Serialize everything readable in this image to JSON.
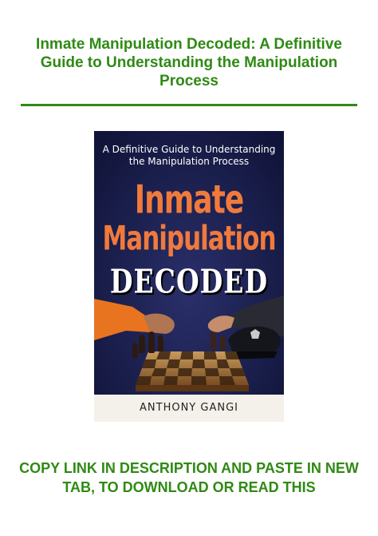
{
  "header": {
    "title": "Inmate Manipulation Decoded: A Definitive Guide to Understanding the Manipulation Process"
  },
  "cover": {
    "subtitle_line1": "A Definitive Guide to Understanding",
    "subtitle_line2": "the Manipulation Process",
    "title_line1": "Inmate",
    "title_line2": "Manipulation",
    "title_line3": "DECODED",
    "author": "ANTHONY GANGI"
  },
  "footer": {
    "cta": "COPY LINK IN DESCRIPTION AND PASTE IN NEW TAB, TO DOWNLOAD OR READ THIS"
  },
  "colors": {
    "accent_green": "#2f8a14",
    "cover_navy": "#141a45",
    "title_orange": "#f07a3c"
  }
}
